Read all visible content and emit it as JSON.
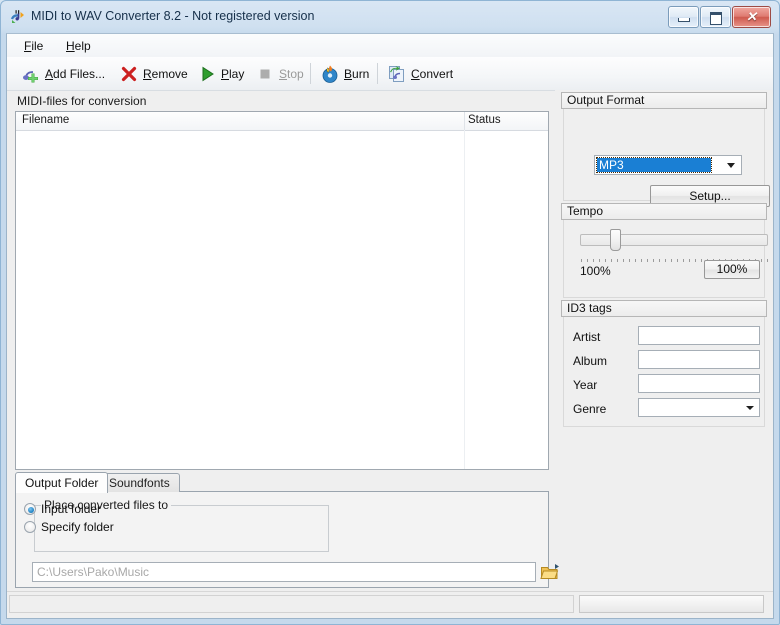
{
  "window": {
    "title": "MIDI to WAV Converter 8.2 - Not registered version",
    "icon": "app-convert-icon",
    "controls": {
      "minimize": "minimize-button",
      "maximize": "maximize-button",
      "close_glyph": "✕"
    }
  },
  "menubar": {
    "items": [
      {
        "label": "File",
        "mnemonic": "F"
      },
      {
        "label": "Help",
        "mnemonic": "H"
      }
    ]
  },
  "toolbar": {
    "items": [
      {
        "label": "Add Files...",
        "icon": "add-note-icon",
        "enabled": true
      },
      {
        "label": "Remove",
        "icon": "red-x-icon",
        "enabled": true
      },
      {
        "label": "Play",
        "icon": "play-triangle-icon",
        "enabled": true
      },
      {
        "label": "Stop",
        "icon": "stop-square-icon",
        "enabled": false
      },
      {
        "label": "Burn",
        "icon": "burn-disc-icon",
        "enabled": true
      },
      {
        "label": "Convert",
        "icon": "convert-pages-icon",
        "enabled": true
      }
    ]
  },
  "filelist": {
    "caption": "MIDI-files for conversion",
    "columns": [
      "Filename",
      "Status"
    ],
    "rows": []
  },
  "tabs": {
    "items": [
      {
        "label": "Output Folder",
        "active": true
      },
      {
        "label": "Soundfonts",
        "active": false
      }
    ],
    "output_folder": {
      "group_title": "Place converted files to",
      "options": [
        {
          "label": "Input folder",
          "selected": true
        },
        {
          "label": "Specify folder",
          "selected": false
        }
      ],
      "path_value": "C:\\Users\\Pako\\Music",
      "browse_icon": "open-folder-icon"
    }
  },
  "output_format": {
    "header": "Output Format",
    "selected": "MP3",
    "setup_label": "Setup..."
  },
  "tempo": {
    "header": "Tempo",
    "value_label": "100%",
    "reset_button": "100%",
    "slider_percent": 25
  },
  "id3": {
    "header": "ID3 tags",
    "fields": [
      {
        "label": "Artist",
        "value": "",
        "type": "text"
      },
      {
        "label": "Album",
        "value": "",
        "type": "text"
      },
      {
        "label": "Year",
        "value": "",
        "type": "text"
      },
      {
        "label": "Genre",
        "value": "",
        "type": "combo"
      }
    ]
  },
  "statusbar": {
    "text": ""
  },
  "colors": {
    "titlebar": "#d2e0ee",
    "selection_blue": "#1a7fd4",
    "close_red": "#cf5a4e",
    "panel_bg": "#efefef"
  }
}
